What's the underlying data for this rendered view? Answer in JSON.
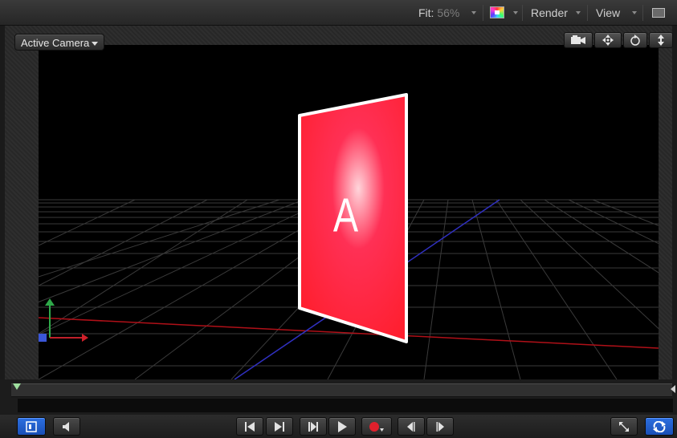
{
  "toolbar": {
    "fit_label": "Fit:",
    "fit_value": "56%",
    "render_label": "Render",
    "view_label": "View"
  },
  "viewport": {
    "camera_menu": "Active Camera",
    "layer_letter": "A",
    "layer_color": "#ff1f3d",
    "tools": [
      "camera-icon",
      "pan-icon",
      "orbit-icon",
      "dolly-icon"
    ]
  },
  "transport": {
    "buttons": [
      "play-range-icon",
      "audio-icon",
      "go-to-start-icon",
      "go-to-end-icon",
      "go-to-play-range-start-icon",
      "play-icon",
      "record-icon",
      "previous-frame-icon",
      "next-frame-icon",
      "fullscreen-icon",
      "loop-icon"
    ]
  },
  "colors": {
    "accent_blue": "#2464d6",
    "record_red": "#e0202c",
    "grid": "#4a4a4a",
    "axis_red": "#c0141c",
    "axis_blue": "#3a3ac8"
  }
}
